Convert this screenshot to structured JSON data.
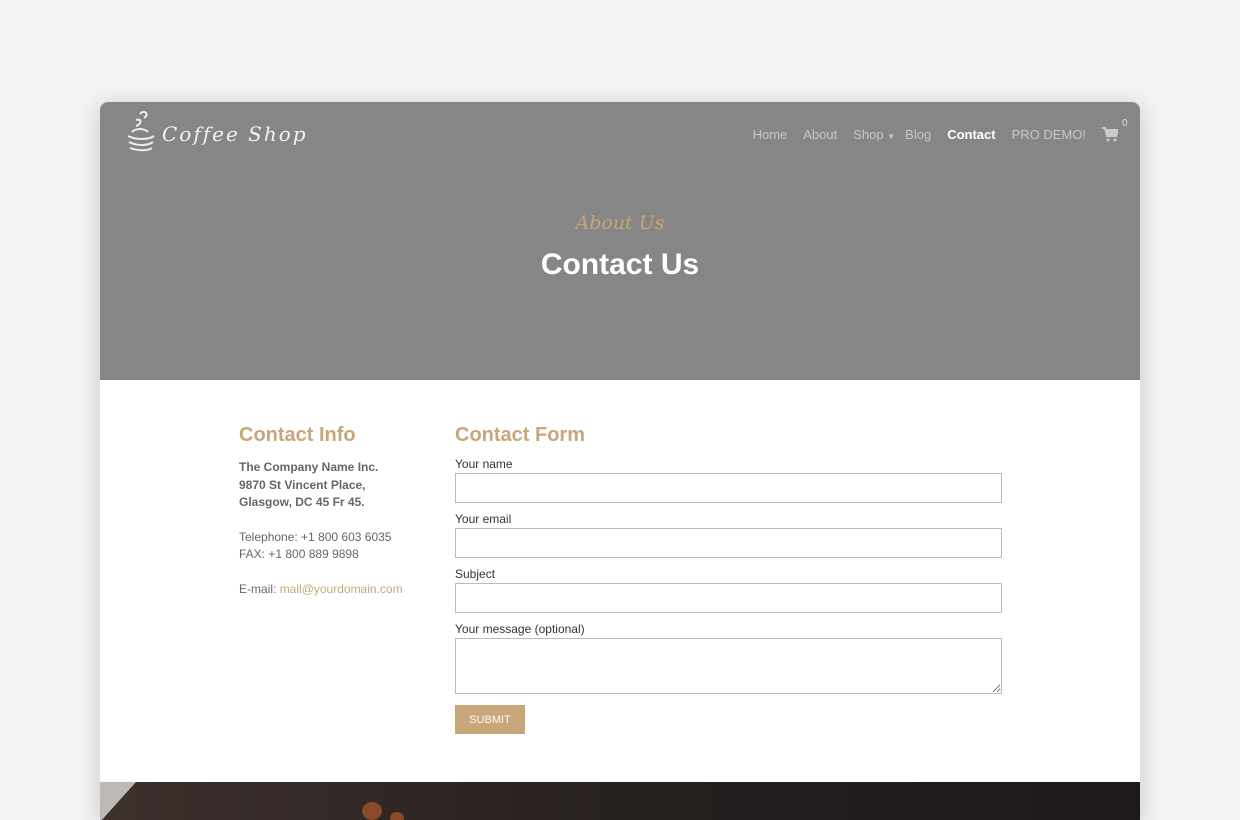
{
  "header": {
    "logo_text": "Coffee Shop",
    "nav": [
      "Home",
      "About",
      "Shop",
      "Blog",
      "Contact",
      "PRO DEMO!"
    ],
    "active": "Contact",
    "cart_count": "0"
  },
  "hero": {
    "subtitle": "About Us",
    "title": "Contact Us"
  },
  "contact_info": {
    "heading": "Contact Info",
    "company": "The Company Name Inc.",
    "address1": "9870 St Vincent Place,",
    "address2": "Glasgow, DC 45 Fr 45.",
    "telephone": "Telephone: +1 800 603 6035",
    "fax": "FAX: +1 800 889 9898",
    "email_label": "E-mail:",
    "email": "mail@yourdomain.com"
  },
  "contact_form": {
    "heading": "Contact Form",
    "name_label": "Your name",
    "email_label": "Your email",
    "subject_label": "Subject",
    "message_label": "Your message (optional)",
    "submit": "SUBMIT"
  },
  "colors": {
    "accent": "#c9a57a",
    "hero_bg": "#868686"
  }
}
